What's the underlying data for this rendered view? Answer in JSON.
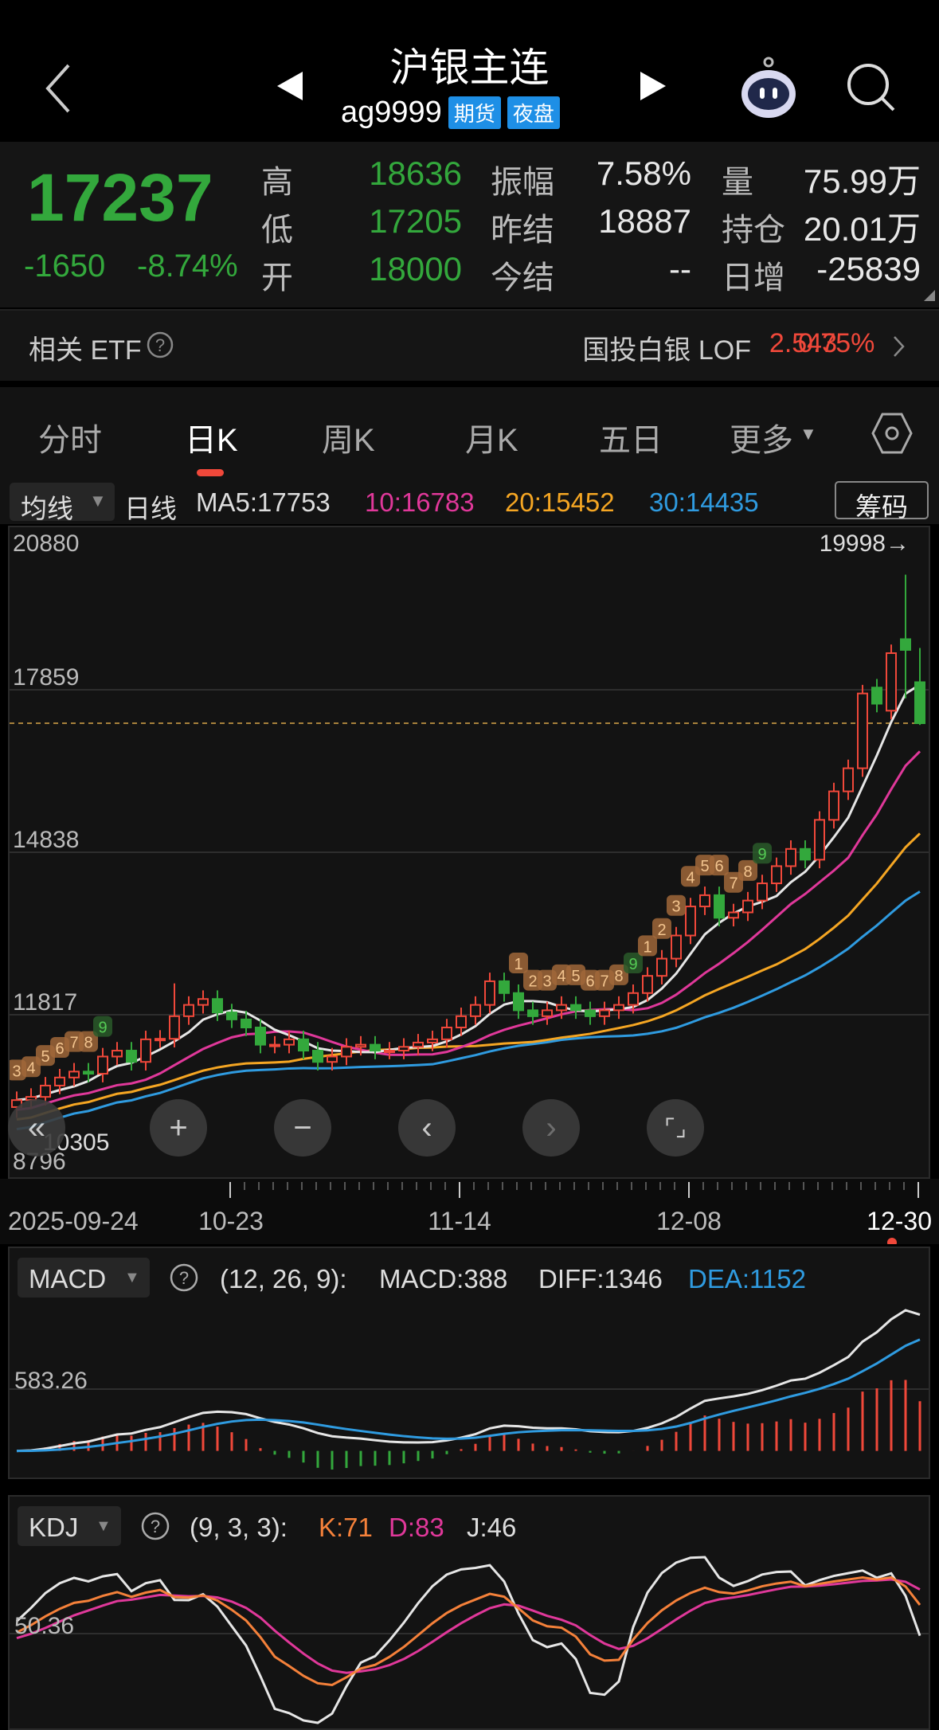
{
  "header": {
    "title": "沪银主连",
    "code": "ag9999",
    "tags": [
      "期货",
      "夜盘"
    ]
  },
  "quote": {
    "price": "17237",
    "change": "-1650",
    "change_pct": "-8.74%",
    "rows": [
      {
        "l1": "高",
        "v1": "18636",
        "l2": "振幅",
        "v2": "7.58%",
        "l3": "量",
        "v3": "75.99万"
      },
      {
        "l1": "低",
        "v1": "17205",
        "l2": "昨结",
        "v2": "18887",
        "l3": "持仓",
        "v3": "20.01万"
      },
      {
        "l1": "开",
        "v1": "18000",
        "l2": "今结",
        "v2": "--",
        "l3": "日增",
        "v3": "-25839"
      }
    ]
  },
  "etf": {
    "label": "相关 ETF",
    "name": "国投白银 LOF",
    "price": "2.543",
    "pct": "0.75%"
  },
  "tabs": [
    "分时",
    "日K",
    "周K",
    "月K",
    "五日",
    "更多"
  ],
  "active_tab": 1,
  "ma": {
    "selector": "均线",
    "period": "日线",
    "ma5": "MA5:17753",
    "ma10": "10:16783",
    "ma20": "20:15452",
    "ma30": "30:14435",
    "chips": "筹码"
  },
  "colors": {
    "up": "#f0483a",
    "down": "#33a83c",
    "ma5": "#e6e6e6",
    "ma10": "#e0389a",
    "ma20": "#f5a623",
    "ma30": "#2f9be0",
    "badge": "#a0673a"
  },
  "chart_data": {
    "type": "candlestick",
    "ylim": [
      8796,
      20880
    ],
    "y_ticks": [
      "20880",
      "17859",
      "14838",
      "11817",
      "8796"
    ],
    "max_label": "19998→",
    "min_label": "10305",
    "current_price": 17237,
    "x_labels": [
      "2025-09-24",
      "10-23",
      "11-14",
      "12-08",
      "12-30"
    ],
    "open": [
      10100,
      10230,
      10290,
      10500,
      10650,
      10760,
      10720,
      11040,
      11150,
      10940,
      11360,
      11370,
      11790,
      12000,
      12110,
      11860,
      11730,
      11580,
      11260,
      11260,
      11360,
      11150,
      10940,
      11040,
      11220,
      11260,
      11150,
      11150,
      11220,
      11300,
      11360,
      11580,
      11790,
      12000,
      12440,
      12220,
      11900,
      11790,
      11900,
      12000,
      11900,
      11790,
      11900,
      12000,
      12220,
      12540,
      12860,
      13290,
      13830,
      14040,
      13620,
      13720,
      13940,
      14260,
      14580,
      14900,
      14700,
      15440,
      15970,
      16400,
      17900,
      17470,
      18800,
      18000
    ],
    "close": [
      10230,
      10290,
      10500,
      10650,
      10760,
      10720,
      11040,
      11150,
      10940,
      11360,
      11370,
      11790,
      12000,
      12110,
      11860,
      11730,
      11580,
      11260,
      11260,
      11360,
      11150,
      10940,
      11040,
      11220,
      11260,
      11150,
      11150,
      11220,
      11300,
      11360,
      11580,
      11790,
      12000,
      12440,
      12220,
      11900,
      11790,
      11900,
      12000,
      11900,
      11790,
      11900,
      12000,
      12220,
      12540,
      12860,
      13290,
      13830,
      14040,
      13620,
      13720,
      13940,
      14260,
      14580,
      14900,
      14700,
      15440,
      15970,
      16400,
      17790,
      17600,
      18540,
      18600,
      17237
    ],
    "high_overrides": {
      "62": 19998,
      "63": 18636,
      "11": 12400
    },
    "low_overrides": {
      "62": 17700,
      "63": 17205,
      "0": 9900
    },
    "td_marks": [
      [
        0,
        "3"
      ],
      [
        1,
        "4"
      ],
      [
        2,
        "5"
      ],
      [
        3,
        "6"
      ],
      [
        4,
        "7"
      ],
      [
        5,
        "8"
      ],
      [
        6,
        "9"
      ],
      [
        35,
        "1"
      ],
      [
        36,
        "2"
      ],
      [
        37,
        "3"
      ],
      [
        38,
        "4"
      ],
      [
        39,
        "5"
      ],
      [
        40,
        "6"
      ],
      [
        41,
        "7"
      ],
      [
        42,
        "8"
      ],
      [
        43,
        "9"
      ],
      [
        44,
        "1"
      ],
      [
        45,
        "2"
      ],
      [
        46,
        "3"
      ],
      [
        47,
        "4"
      ],
      [
        48,
        "5"
      ],
      [
        49,
        "6"
      ],
      [
        50,
        "7"
      ],
      [
        51,
        "8"
      ],
      [
        52,
        "9"
      ]
    ],
    "macd": {
      "label": "MACD",
      "params": "(12, 26, 9):",
      "macd": "MACD:388",
      "diff": "DIFF:1346",
      "dea": "DEA:1152",
      "grid": "583.26"
    },
    "kdj": {
      "label": "KDJ",
      "params": "(9, 3, 3):",
      "k": "K:71",
      "d": "D:83",
      "j": "J:46",
      "grid": "50.36"
    }
  }
}
